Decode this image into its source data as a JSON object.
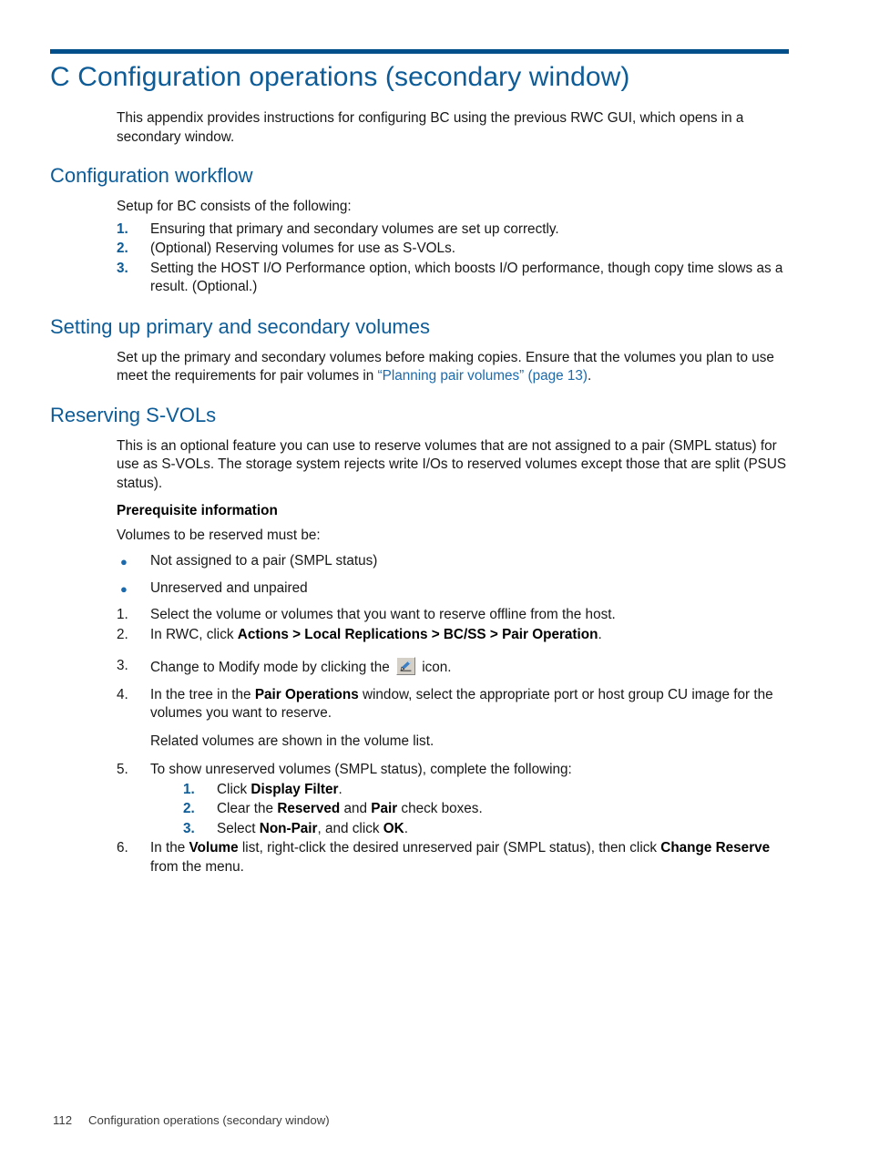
{
  "page": {
    "chapter_heading": "C Configuration operations (secondary window)",
    "intro": "This appendix provides instructions for configuring BC using the previous RWC GUI, which opens in a secondary window."
  },
  "sections": {
    "workflow": {
      "heading": "Configuration workflow",
      "intro": "Setup for BC consists of the following:",
      "steps": [
        {
          "num": "1.",
          "text": "Ensuring that primary and secondary volumes are set up correctly."
        },
        {
          "num": "2.",
          "text": "(Optional) Reserving volumes for use as S-VOLs."
        },
        {
          "num": "3.",
          "text": "Setting the HOST I/O Performance option, which boosts I/O performance, though copy time slows as a result. (Optional.)"
        }
      ]
    },
    "setup_volumes": {
      "heading": "Setting up primary and secondary volumes",
      "body_part1": "Set up the primary and secondary volumes before making copies. Ensure that the volumes you plan to use meet the requirements for pair volumes in ",
      "link_text": "“Planning pair volumes” (page 13)",
      "body_part2": "."
    },
    "reserving": {
      "heading": "Reserving S-VOLs",
      "intro": "This is an optional feature you can use to reserve volumes that are not assigned to a pair (SMPL status) for use as S-VOLs. The storage system rejects write I/Os to reserved volumes except those that are split (PSUS status).",
      "prereq_heading": "Prerequisite information",
      "prereq_intro": "Volumes to be reserved must be:",
      "bullets": [
        "Not assigned to a pair (SMPL status)",
        "Unreserved and unpaired"
      ],
      "steps": {
        "s1": {
          "num": "1.",
          "text": "Select the volume or volumes that you want to reserve offline from the host."
        },
        "s2": {
          "num": "2.",
          "pre": "In RWC, click ",
          "bold": "Actions > Local Replications > BC/SS > Pair Operation",
          "post": "."
        },
        "s3": {
          "num": "3.",
          "pre": "Change to Modify mode by clicking the ",
          "icon": "pencil-icon",
          "post": " icon."
        },
        "s4": {
          "num": "4.",
          "pre": "In the tree in the ",
          "bold": "Pair Operations",
          "post": " window, select the appropriate port or host group CU image for the volumes you want to reserve.",
          "note": "Related volumes are shown in the volume list."
        },
        "s5": {
          "num": "5.",
          "text": "To show unreserved volumes (SMPL status), complete the following:",
          "substeps": [
            {
              "num": "1.",
              "pre": "Click ",
              "bold": "Display Filter",
              "post": "."
            },
            {
              "num": "2.",
              "pre": "Clear the ",
              "bold": "Reserved",
              "mid": " and ",
              "bold2": "Pair",
              "post": " check boxes."
            },
            {
              "num": "3.",
              "pre": "Select ",
              "bold": "Non-Pair",
              "mid": ", and click ",
              "bold2": "OK",
              "post": "."
            }
          ]
        },
        "s6": {
          "num": "6.",
          "pre": "In the ",
          "bold": "Volume",
          "mid": " list, right-click the desired unreserved pair (SMPL status), then click ",
          "bold2": "Change Reserve",
          "post": " from the menu."
        }
      }
    }
  },
  "footer": {
    "page_number": "112",
    "text": "Configuration operations (secondary window)"
  },
  "colors": {
    "heading_blue": "#0d5c98",
    "rule_blue": "#004f8b",
    "link_blue": "#1a6aad",
    "bullet_blue": "#1a6aad"
  }
}
